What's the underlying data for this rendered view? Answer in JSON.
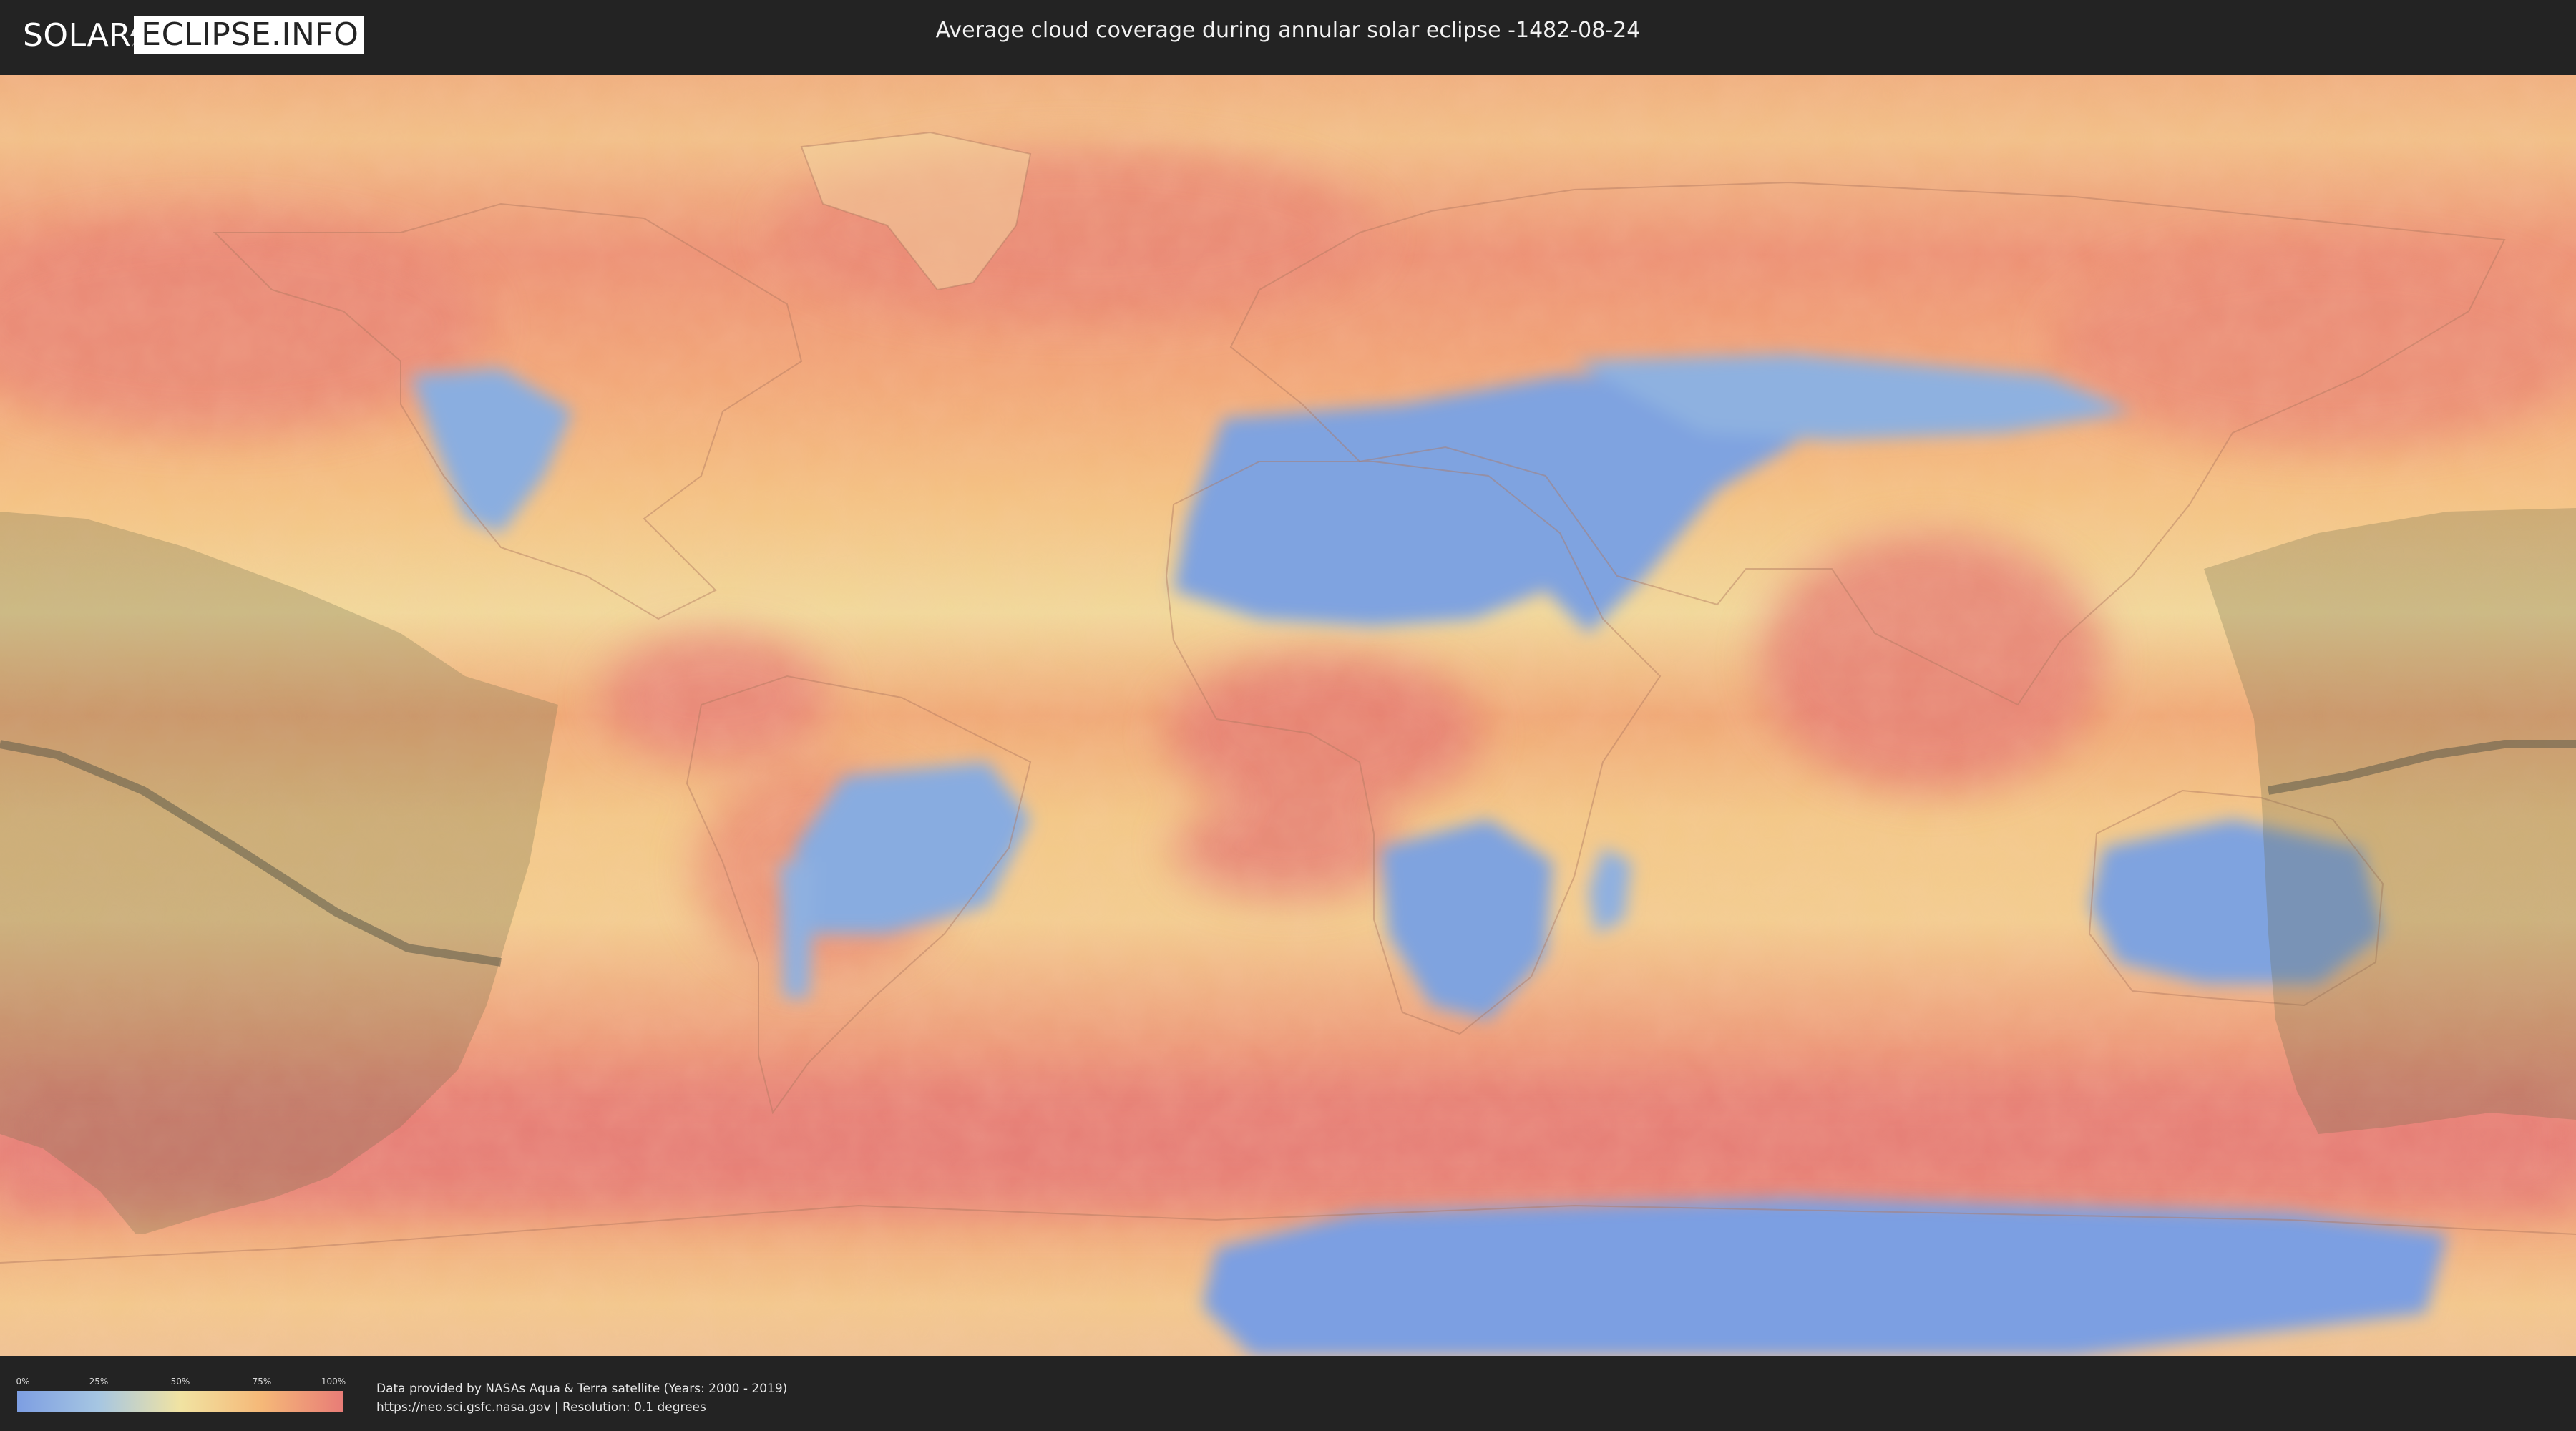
{
  "header": {
    "logo_part1": "SOLAR",
    "logo_part2": "ECLIPSE.INFO",
    "title": "Average cloud coverage during annular solar eclipse -1482-08-24"
  },
  "legend": {
    "labels": [
      "0%",
      "25%",
      "50%",
      "75%",
      "100%"
    ],
    "colors": [
      "#7d9ee2",
      "#a6c6e2",
      "#f1e3a2",
      "#f5b878",
      "#e87c77"
    ]
  },
  "footer": {
    "credit_line1": "Data provided by NASAs Aqua & Terra satellite (Years: 2000 - 2019)",
    "credit_line2": "https://neo.sci.gsfc.nasa.gov | Resolution: 0.1 degrees"
  },
  "map": {
    "kind": "world cloud-cover map, equirectangular",
    "eclipse_overlay": "shaded eclipse visibility zone with central annular path line"
  }
}
